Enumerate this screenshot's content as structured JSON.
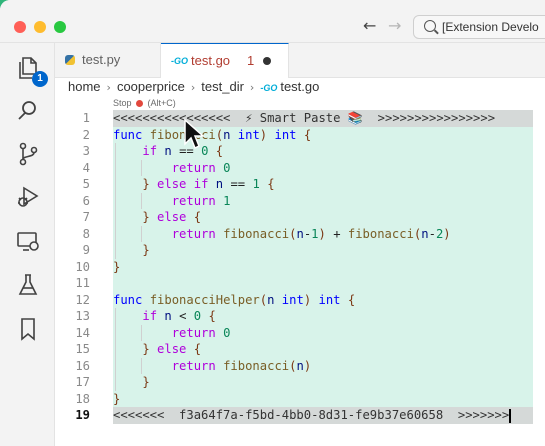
{
  "search": {
    "text": "[Extension Develo"
  },
  "tabs": [
    {
      "label": "test.py"
    },
    {
      "label": "test.go",
      "problems": "1"
    }
  ],
  "breadcrumb": [
    "home",
    "cooperprice",
    "test_dir",
    "test.go"
  ],
  "stop_hint": {
    "before": "Stop",
    "shortcut": "(Alt+C)"
  },
  "activity": {
    "explorer_badge": "1"
  },
  "editor": {
    "active_line": 19,
    "lines": [
      {
        "n": "1",
        "text": "<<<<<<<<<<<<<<<<  ⚡ Smart Paste 📚  >>>>>>>>>>>>>>>>"
      },
      {
        "n": "2",
        "text": "func fibonacci(n int) int {"
      },
      {
        "n": "3",
        "text": "    if n == 0 {"
      },
      {
        "n": "4",
        "text": "        return 0"
      },
      {
        "n": "5",
        "text": "    } else if n == 1 {"
      },
      {
        "n": "6",
        "text": "        return 1"
      },
      {
        "n": "7",
        "text": "    } else {"
      },
      {
        "n": "8",
        "text": "        return fibonacci(n-1) + fibonacci(n-2)"
      },
      {
        "n": "9",
        "text": "    }"
      },
      {
        "n": "10",
        "text": "}"
      },
      {
        "n": "11",
        "text": ""
      },
      {
        "n": "12",
        "text": "func fibonacciHelper(n int) int {"
      },
      {
        "n": "13",
        "text": "    if n < 0 {"
      },
      {
        "n": "14",
        "text": "        return 0"
      },
      {
        "n": "15",
        "text": "    } else {"
      },
      {
        "n": "16",
        "text": "        return fibonacci(n)"
      },
      {
        "n": "17",
        "text": "    }"
      },
      {
        "n": "18",
        "text": "}"
      },
      {
        "n": "19",
        "text": "<<<<<<<  f3a64f7a-f5bd-4bb0-8d31-fe9b37e60658  >>>>>>>"
      }
    ]
  }
}
